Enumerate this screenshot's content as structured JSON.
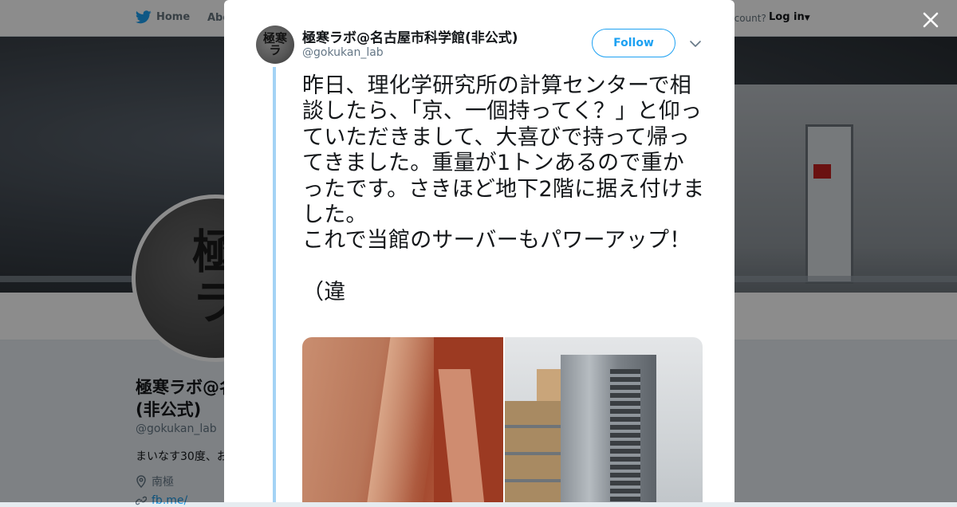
{
  "nav": {
    "home_label": "Home",
    "about_label": "Abo",
    "account_text": "ccount?",
    "login_label": "Log in"
  },
  "profile": {
    "avatar_glyph": "極\nラ",
    "name": "極寒ラボ@名\n(非公式)",
    "handle": "@gokukan_lab",
    "bio": "まいなす30度、お",
    "location": "南極",
    "link": "fb.me/"
  },
  "modal": {
    "avatar_glyph": "極寒\nラ",
    "name": "極寒ラボ@名古屋市科学館(非公式)",
    "handle": "@gokukan_lab",
    "follow_label": "Follow",
    "tweet_text": "昨日、理化学研究所の計算センターで相談したら、「京、一個持ってく？」と仰っていただきまして、大喜びで持って帰ってきました。重量が1トンあるので重かったです。さきほど地下2階に据え付けました。\nこれで当館のサーバーもパワーアップ！\n\n（違"
  },
  "colors": {
    "twitter_blue": "#1da1f2",
    "thread_line": "#a3d3f5",
    "text_primary": "#14171a",
    "text_secondary": "#657786"
  },
  "icons": {
    "nav_home": "twitter-bird-icon",
    "close": "close-icon",
    "more": "chevron-down-icon",
    "location": "location-pin-icon",
    "link": "link-icon"
  }
}
